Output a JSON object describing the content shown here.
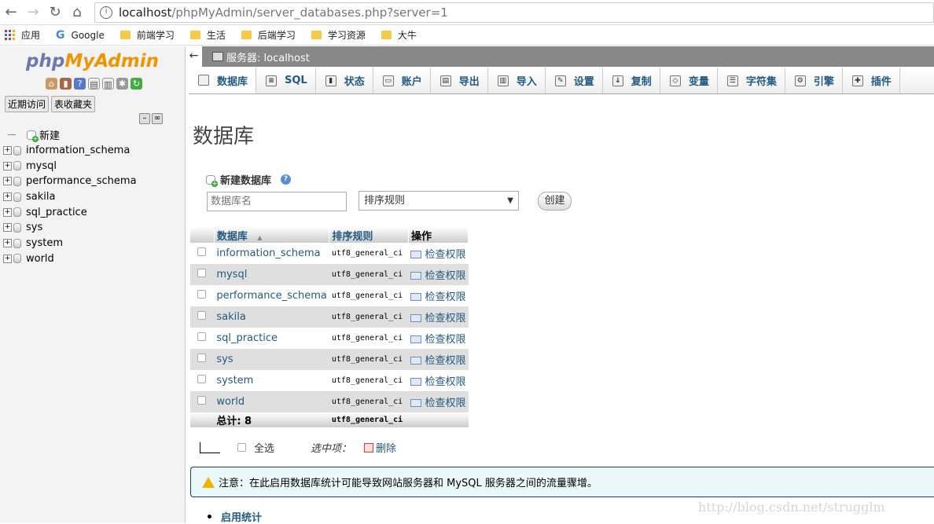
{
  "browser": {
    "url_host": "localhost",
    "url_path": "/phpMyAdmin/server_databases.php?server=1",
    "bookmarks": [
      "应用",
      "Google",
      "前端学习",
      "生活",
      "后端学习",
      "学习资源",
      "大牛"
    ]
  },
  "leftnav": {
    "logo_php": "php",
    "logo_myadmin": "MyAdmin",
    "tabs": [
      "近期访问",
      "表收藏夹"
    ],
    "new_label": "新建",
    "databases": [
      "information_schema",
      "mysql",
      "performance_schema",
      "sakila",
      "sql_practice",
      "sys",
      "system",
      "world"
    ]
  },
  "main": {
    "breadcrumb": "服务器: localhost",
    "tabs": [
      "数据库",
      "SQL",
      "状态",
      "账户",
      "导出",
      "导入",
      "设置",
      "复制",
      "变量",
      "字符集",
      "引擎",
      "插件"
    ],
    "page_title": "数据库",
    "create": {
      "title": "新建数据库",
      "name_placeholder": "数据库名",
      "collation_selected": "排序规则",
      "button": "创建"
    },
    "table": {
      "headers": [
        "数据库",
        "排序规则",
        "操作"
      ],
      "rows": [
        {
          "name": "information_schema",
          "collation": "utf8_general_ci",
          "action": "检查权限"
        },
        {
          "name": "mysql",
          "collation": "utf8_general_ci",
          "action": "检查权限"
        },
        {
          "name": "performance_schema",
          "collation": "utf8_general_ci",
          "action": "检查权限"
        },
        {
          "name": "sakila",
          "collation": "utf8_general_ci",
          "action": "检查权限"
        },
        {
          "name": "sql_practice",
          "collation": "utf8_general_ci",
          "action": "检查权限"
        },
        {
          "name": "sys",
          "collation": "utf8_general_ci",
          "action": "检查权限"
        },
        {
          "name": "system",
          "collation": "utf8_general_ci",
          "action": "检查权限"
        },
        {
          "name": "world",
          "collation": "utf8_general_ci",
          "action": "检查权限"
        }
      ],
      "total_label": "总计: 8",
      "total_collation": "utf8_general_ci"
    },
    "bulk": {
      "select_all": "全选",
      "with_selected": "选中项：",
      "delete": "删除"
    },
    "notice": "注意：在此启用数据库统计可能导致网站服务器和 MySQL 服务器之间的流量骤增。",
    "enable_stats": "启用统计"
  },
  "watermark": "http://blog.csdn.net/strugglm"
}
